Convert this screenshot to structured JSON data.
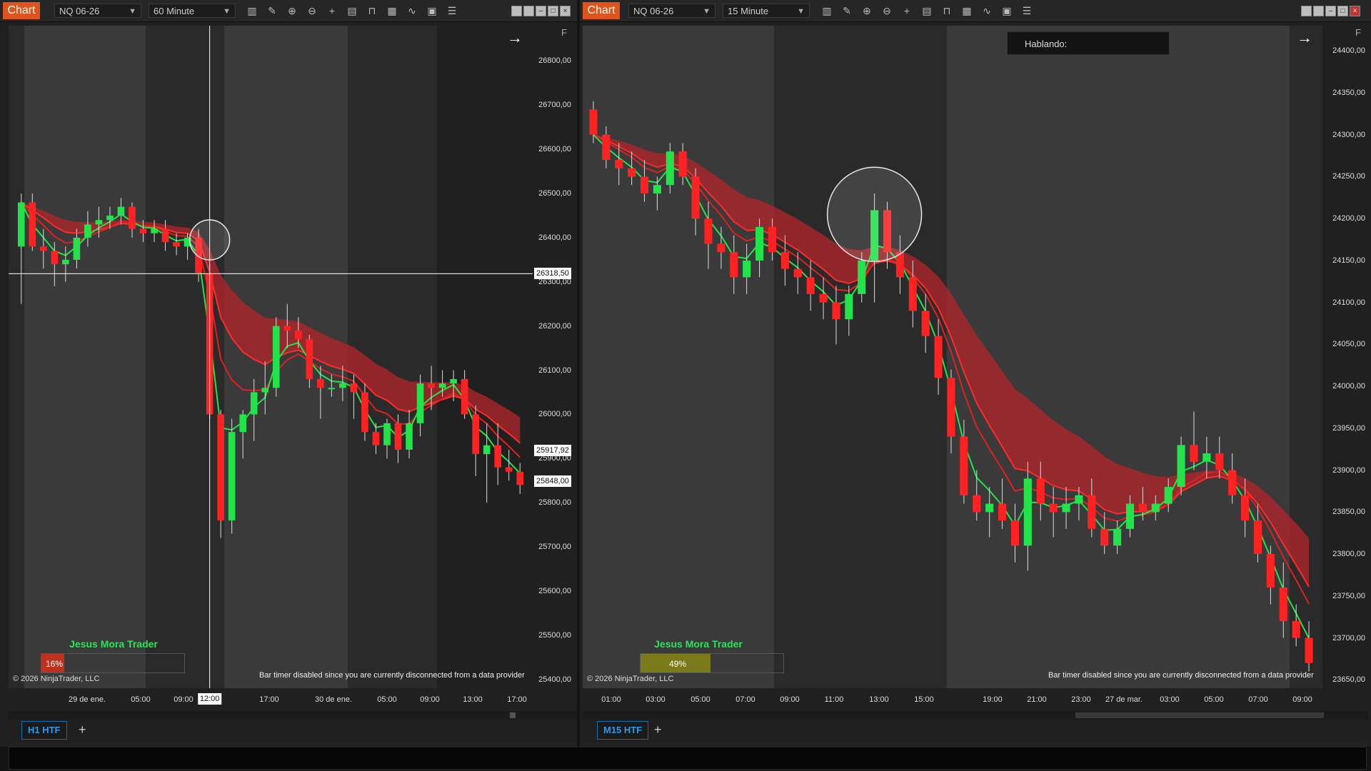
{
  "left": {
    "toolbar": {
      "chart_button": "Chart",
      "instrument": "NQ 06-26",
      "interval": "60 Minute"
    },
    "y_labels": [
      "26800,00",
      "26700,00",
      "26600,00",
      "26500,00",
      "26400,00",
      "26300,00",
      "26200,00",
      "26100,00",
      "26000,00",
      "25900,00",
      "25800,00",
      "25700,00",
      "25600,00",
      "25500,00",
      "25400,00"
    ],
    "price_tags": [
      "26318,50",
      "25917,92",
      "25848,00"
    ],
    "x_labels": [
      "29 de ene.",
      "05:00",
      "09:00",
      "17:00",
      "30 de ene.",
      "05:00",
      "09:00",
      "13:00",
      "17:00"
    ],
    "crosshair_time": "12:00",
    "brand": "Jesus Mora Trader",
    "timer_percent": "16%",
    "copyright": "© 2026 NinjaTrader, LLC",
    "message": "Bar timer disabled since you are currently disconnected from a data provider",
    "tab": "H1 HTF",
    "tab_add": "+",
    "f_button": "F",
    "nav_arrow": "→"
  },
  "right": {
    "toolbar": {
      "chart_button": "Chart",
      "instrument": "NQ 06-26",
      "interval": "15 Minute"
    },
    "y_labels": [
      "24400,00",
      "24350,00",
      "24300,00",
      "24250,00",
      "24200,00",
      "24150,00",
      "24100,00",
      "24050,00",
      "24000,00",
      "23950,00",
      "23900,00",
      "23850,00",
      "23800,00",
      "23750,00",
      "23700,00",
      "23650,00"
    ],
    "x_labels": [
      "01:00",
      "03:00",
      "05:00",
      "07:00",
      "09:00",
      "11:00",
      "13:00",
      "15:00",
      "19:00",
      "21:00",
      "23:00",
      "27 de mar.",
      "03:00",
      "05:00",
      "07:00",
      "09:00"
    ],
    "brand": "Jesus Mora Trader",
    "timer_percent": "49%",
    "copyright": "© 2026 NinjaTrader, LLC",
    "message": "Bar timer disabled since you are currently disconnected from a data provider",
    "tab": "M15 HTF",
    "tab_add": "+",
    "f_button": "F",
    "nav_arrow": "→",
    "speech_label": "Hablando:"
  },
  "colors": {
    "accent": "#e0541c",
    "bull": "#22e34a",
    "bear": "#ff2222",
    "band": "#b3262b",
    "tab": "#2f9ae6"
  },
  "chart_data": [
    {
      "type": "candlestick",
      "instrument": "NQ 06-26",
      "interval": "60 Minute",
      "ylim": [
        25380,
        26880
      ],
      "ohlc": [
        [
          26380,
          26500,
          26250,
          26480
        ],
        [
          26480,
          26500,
          26370,
          26380
        ],
        [
          26380,
          26420,
          26330,
          26370
        ],
        [
          26370,
          26390,
          26290,
          26340
        ],
        [
          26340,
          26380,
          26300,
          26350
        ],
        [
          26350,
          26420,
          26330,
          26400
        ],
        [
          26400,
          26460,
          26380,
          26430
        ],
        [
          26430,
          26470,
          26400,
          26440
        ],
        [
          26440,
          26470,
          26420,
          26450
        ],
        [
          26450,
          26490,
          26430,
          26470
        ],
        [
          26470,
          26480,
          26400,
          26420
        ],
        [
          26420,
          26440,
          26390,
          26410
        ],
        [
          26410,
          26440,
          26390,
          26420
        ],
        [
          26420,
          26440,
          26370,
          26390
        ],
        [
          26390,
          26410,
          26360,
          26380
        ],
        [
          26380,
          26410,
          26350,
          26400
        ],
        [
          26400,
          26420,
          26300,
          26320
        ],
        [
          26320,
          26340,
          25990,
          26000
        ],
        [
          26000,
          26010,
          25720,
          25760
        ],
        [
          25760,
          25990,
          25730,
          25960
        ],
        [
          25960,
          26010,
          25900,
          26000
        ],
        [
          26000,
          26080,
          25940,
          26050
        ],
        [
          26050,
          26120,
          26000,
          26060
        ],
        [
          26060,
          26220,
          26040,
          26200
        ],
        [
          26200,
          26250,
          26150,
          26190
        ],
        [
          26190,
          26220,
          26150,
          26170
        ],
        [
          26170,
          26180,
          26060,
          26080
        ],
        [
          26080,
          26110,
          25990,
          26060
        ],
        [
          26060,
          26090,
          26040,
          26060
        ],
        [
          26060,
          26110,
          26030,
          26070
        ],
        [
          26070,
          26090,
          25990,
          26050
        ],
        [
          26050,
          26070,
          25940,
          25960
        ],
        [
          25960,
          25980,
          25910,
          25930
        ],
        [
          25930,
          25990,
          25900,
          25980
        ],
        [
          25980,
          26000,
          25890,
          25920
        ],
        [
          25920,
          26010,
          25900,
          25980
        ],
        [
          25980,
          26090,
          25950,
          26070
        ],
        [
          26070,
          26110,
          26010,
          26060
        ],
        [
          26060,
          26100,
          26040,
          26070
        ],
        [
          26070,
          26100,
          26030,
          26080
        ],
        [
          26080,
          26100,
          25990,
          26000
        ],
        [
          26000,
          26020,
          25860,
          25910
        ],
        [
          25910,
          25980,
          25800,
          25930
        ],
        [
          25930,
          25980,
          25840,
          25880
        ],
        [
          25880,
          25920,
          25850,
          25870
        ],
        [
          25870,
          25890,
          25820,
          25840
        ]
      ]
    },
    {
      "type": "candlestick",
      "instrument": "NQ 06-26",
      "interval": "15 Minute",
      "ylim": [
        23640,
        24430
      ],
      "ohlc": [
        [
          24330,
          24340,
          24290,
          24300
        ],
        [
          24300,
          24310,
          24260,
          24270
        ],
        [
          24270,
          24290,
          24240,
          24260
        ],
        [
          24260,
          24280,
          24240,
          24250
        ],
        [
          24250,
          24270,
          24220,
          24230
        ],
        [
          24230,
          24250,
          24210,
          24240
        ],
        [
          24240,
          24290,
          24230,
          24280
        ],
        [
          24280,
          24290,
          24240,
          24250
        ],
        [
          24250,
          24260,
          24180,
          24200
        ],
        [
          24200,
          24220,
          24140,
          24170
        ],
        [
          24170,
          24190,
          24140,
          24160
        ],
        [
          24160,
          24180,
          24110,
          24130
        ],
        [
          24130,
          24170,
          24110,
          24150
        ],
        [
          24150,
          24200,
          24130,
          24190
        ],
        [
          24190,
          24200,
          24150,
          24160
        ],
        [
          24160,
          24180,
          24120,
          24140
        ],
        [
          24140,
          24160,
          24110,
          24130
        ],
        [
          24130,
          24150,
          24090,
          24110
        ],
        [
          24110,
          24130,
          24080,
          24100
        ],
        [
          24100,
          24120,
          24050,
          24080
        ],
        [
          24080,
          24120,
          24060,
          24110
        ],
        [
          24110,
          24160,
          24100,
          24150
        ],
        [
          24150,
          24230,
          24100,
          24210
        ],
        [
          24210,
          24220,
          24140,
          24160
        ],
        [
          24160,
          24180,
          24110,
          24130
        ],
        [
          24130,
          24150,
          24070,
          24090
        ],
        [
          24090,
          24110,
          24040,
          24060
        ],
        [
          24060,
          24080,
          23990,
          24010
        ],
        [
          24010,
          24020,
          23920,
          23940
        ],
        [
          23940,
          23960,
          23860,
          23870
        ],
        [
          23870,
          23900,
          23840,
          23850
        ],
        [
          23850,
          23880,
          23820,
          23860
        ],
        [
          23860,
          23890,
          23830,
          23840
        ],
        [
          23840,
          23860,
          23790,
          23810
        ],
        [
          23810,
          23910,
          23780,
          23890
        ],
        [
          23890,
          23910,
          23840,
          23860
        ],
        [
          23860,
          23880,
          23820,
          23850
        ],
        [
          23850,
          23880,
          23830,
          23860
        ],
        [
          23860,
          23880,
          23840,
          23870
        ],
        [
          23870,
          23890,
          23820,
          23830
        ],
        [
          23830,
          23850,
          23800,
          23810
        ],
        [
          23810,
          23840,
          23800,
          23830
        ],
        [
          23830,
          23870,
          23820,
          23860
        ],
        [
          23860,
          23880,
          23840,
          23850
        ],
        [
          23850,
          23870,
          23840,
          23860
        ],
        [
          23860,
          23890,
          23850,
          23880
        ],
        [
          23880,
          23940,
          23870,
          23930
        ],
        [
          23930,
          23970,
          23900,
          23910
        ],
        [
          23910,
          23940,
          23890,
          23920
        ],
        [
          23920,
          23940,
          23890,
          23900
        ],
        [
          23900,
          23920,
          23860,
          23870
        ],
        [
          23870,
          23890,
          23820,
          23840
        ],
        [
          23840,
          23860,
          23790,
          23800
        ],
        [
          23800,
          23810,
          23740,
          23760
        ],
        [
          23760,
          23790,
          23700,
          23720
        ],
        [
          23720,
          23740,
          23690,
          23700
        ],
        [
          23700,
          23720,
          23660,
          23670
        ]
      ]
    }
  ]
}
